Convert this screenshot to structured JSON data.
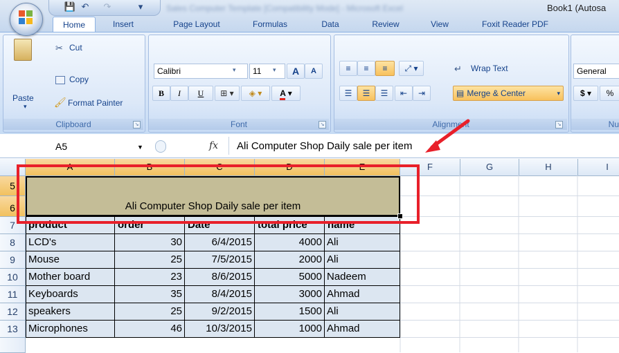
{
  "window": {
    "title_blurred": "Sales Computer Template [Compatibility Mode] - Microsoft Excel",
    "book_title": "Book1 (Autosa"
  },
  "quick_access": {
    "save": "💾",
    "undo": "↶",
    "redo": "↷",
    "customize": "▾"
  },
  "tabs": [
    "Home",
    "Insert",
    "Page Layout",
    "Formulas",
    "Data",
    "Review",
    "View",
    "Foxit Reader PDF"
  ],
  "ribbon": {
    "clipboard": {
      "label": "Clipboard",
      "paste": "Paste",
      "cut": "Cut",
      "copy": "Copy",
      "format_painter": "Format Painter"
    },
    "font": {
      "label": "Font",
      "name": "Calibri",
      "size": "11",
      "grow": "A",
      "shrink": "A",
      "bold": "B",
      "italic": "I",
      "underline": "U",
      "font_color": "A"
    },
    "alignment": {
      "label": "Alignment",
      "wrap_text": "Wrap Text",
      "merge_center": "Merge & Center"
    },
    "number": {
      "label": "Nu",
      "format": "General",
      "currency": "$",
      "percent": "%"
    }
  },
  "formula_bar": {
    "name_box": "A5",
    "fx": "fx",
    "value": "Ali Computer Shop Daily sale per item"
  },
  "columns": [
    "A",
    "B",
    "C",
    "D",
    "E",
    "F",
    "G",
    "H",
    "I"
  ],
  "merged_title": "Ali Computer Shop Daily sale per item",
  "header_row": {
    "row": "7",
    "cells": [
      "product",
      "order",
      "Date",
      "total price",
      "name"
    ]
  },
  "rows": [
    {
      "row": "5"
    },
    {
      "row": "6"
    },
    {
      "row": "8",
      "cells": [
        "LCD's",
        "30",
        "6/4/2015",
        "4000",
        "Ali"
      ]
    },
    {
      "row": "9",
      "cells": [
        "Mouse",
        "25",
        "7/5/2015",
        "2000",
        "Ali"
      ]
    },
    {
      "row": "10",
      "cells": [
        "Mother board",
        "23",
        "8/6/2015",
        "5000",
        "Nadeem"
      ]
    },
    {
      "row": "11",
      "cells": [
        "Keyboards",
        "35",
        "8/4/2015",
        "3000",
        "Ahmad"
      ]
    },
    {
      "row": "12",
      "cells": [
        "speakers",
        "25",
        "9/2/2015",
        "1500",
        "Ali"
      ]
    },
    {
      "row": "13",
      "cells": [
        "Microphones",
        "46",
        "10/3/2015",
        "1000",
        "Ahmad"
      ]
    }
  ],
  "colors": {
    "highlight": "#e8202a",
    "merge_fill": "#c4bd97",
    "table_fill": "#dce6f1",
    "selection": "#f1c15f"
  }
}
